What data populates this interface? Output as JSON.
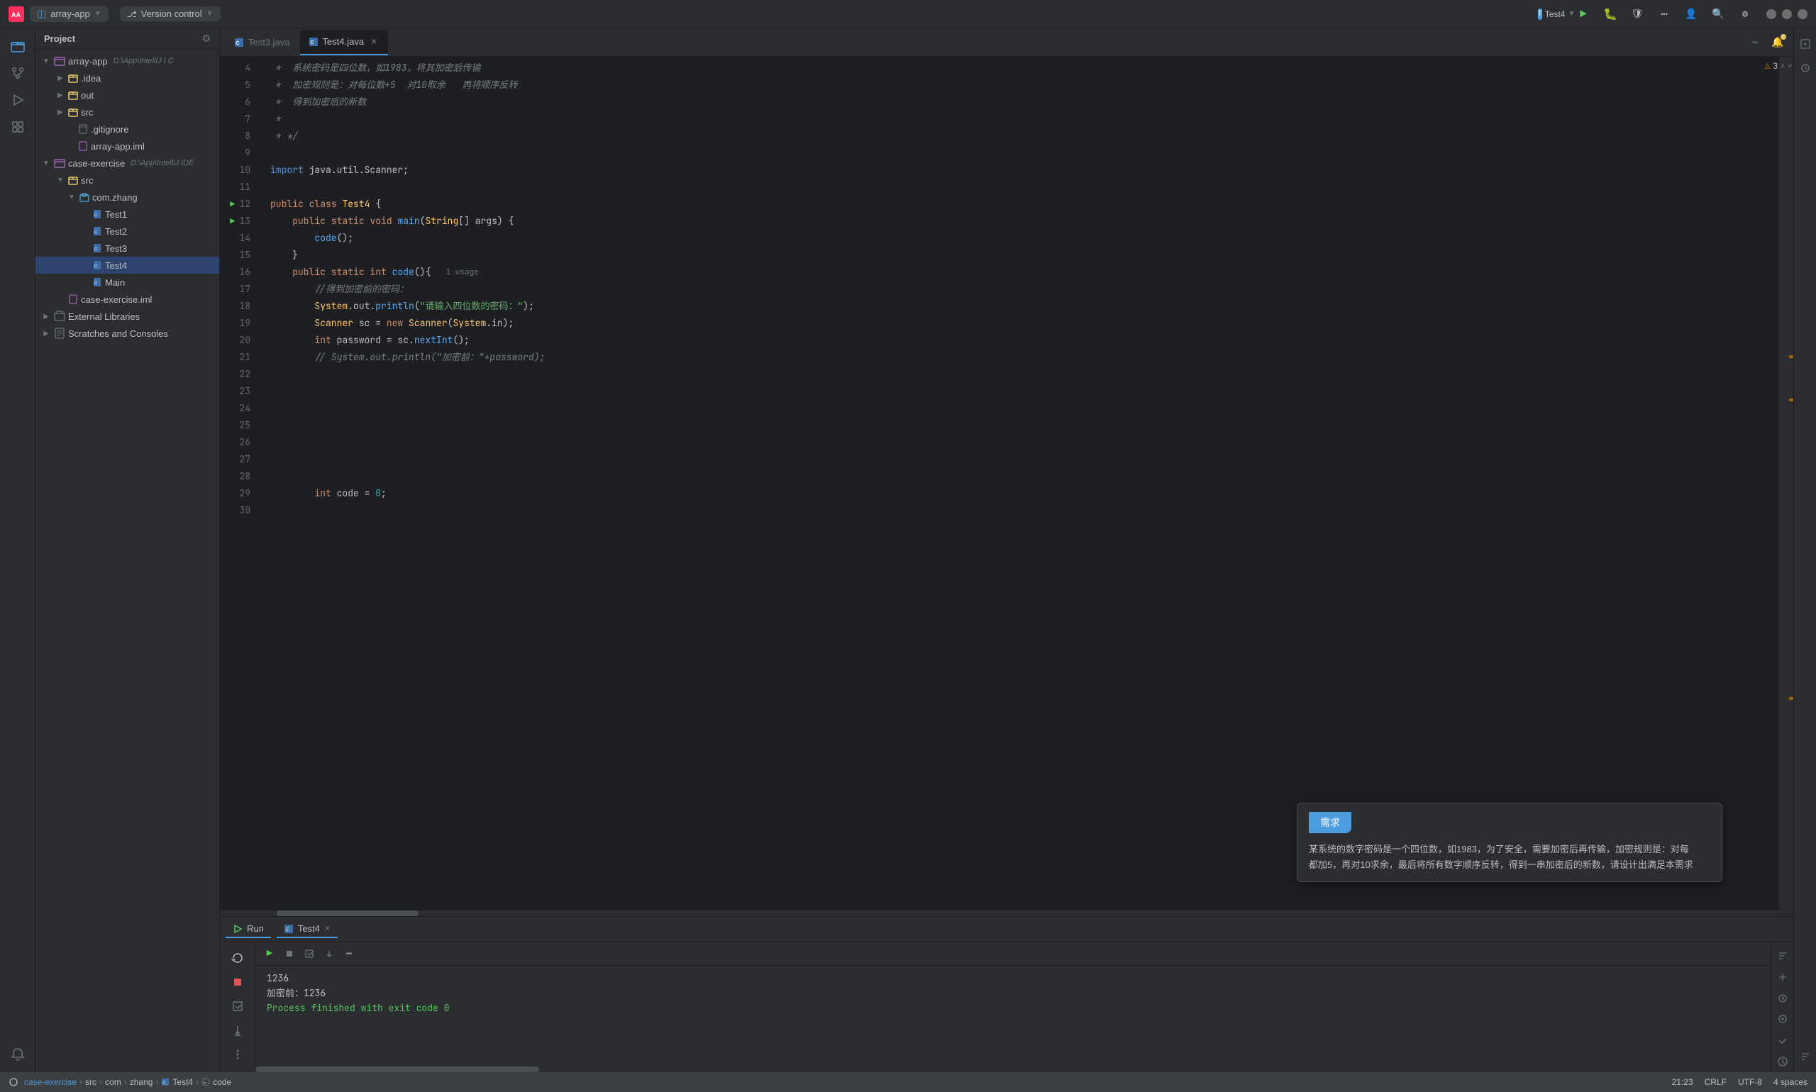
{
  "titlebar": {
    "logo": "AA",
    "project_name": "array-app",
    "vcs_label": "Version control",
    "run_btn": "▶",
    "debug_btn": "🐛",
    "more_btn": "⋯",
    "user_btn": "👤",
    "search_btn": "🔍",
    "settings_btn": "⚙"
  },
  "project": {
    "header": "Project",
    "tree": [
      {
        "id": "array-app",
        "label": "array-app",
        "module": "D:\\App\\IntelliJ I C",
        "level": 0,
        "type": "module",
        "expanded": true
      },
      {
        "id": "idea",
        "label": ".idea",
        "level": 1,
        "type": "folder",
        "expanded": false
      },
      {
        "id": "out",
        "label": "out",
        "level": 1,
        "type": "folder",
        "expanded": false
      },
      {
        "id": "src",
        "label": "src",
        "level": 1,
        "type": "folder",
        "expanded": false
      },
      {
        "id": "gitignore",
        "label": ".gitignore",
        "level": 1,
        "type": "file"
      },
      {
        "id": "array-app-iml",
        "label": "array-app.iml",
        "level": 1,
        "type": "iml"
      },
      {
        "id": "case-exercise",
        "label": "case-exercise",
        "module": "D:\\App\\IntelliJ IDE",
        "level": 0,
        "type": "module",
        "expanded": true
      },
      {
        "id": "src2",
        "label": "src",
        "level": 1,
        "type": "folder",
        "expanded": true
      },
      {
        "id": "com-zhang",
        "label": "com.zhang",
        "level": 2,
        "type": "package",
        "expanded": true
      },
      {
        "id": "Test1",
        "label": "Test1",
        "level": 3,
        "type": "java"
      },
      {
        "id": "Test2",
        "label": "Test2",
        "level": 3,
        "type": "java"
      },
      {
        "id": "Test3",
        "label": "Test3",
        "level": 3,
        "type": "java"
      },
      {
        "id": "Test4",
        "label": "Test4",
        "level": 3,
        "type": "java",
        "selected": true
      },
      {
        "id": "Main",
        "label": "Main",
        "level": 3,
        "type": "java"
      },
      {
        "id": "case-exercise-iml",
        "label": "case-exercise.iml",
        "level": 1,
        "type": "iml"
      },
      {
        "id": "ext-libs",
        "label": "External Libraries",
        "level": 0,
        "type": "ext-lib",
        "expanded": false
      },
      {
        "id": "scratches",
        "label": "Scratches and Consoles",
        "level": 0,
        "type": "scratches",
        "expanded": false
      }
    ]
  },
  "tabs": [
    {
      "id": "test3",
      "label": "Test3.java",
      "type": "java",
      "active": false
    },
    {
      "id": "test4",
      "label": "Test4.java",
      "type": "java",
      "active": true
    }
  ],
  "editor": {
    "warning_count": "⚠ 3",
    "lines": [
      {
        "num": 4,
        "code": " *  系统密码是四位数，如1983，将其加密后传输",
        "type": "comment"
      },
      {
        "num": 5,
        "code": " *  加密规则是：对每位数+5  对10取余   再将顺序反转",
        "type": "comment"
      },
      {
        "num": 6,
        "code": " *  得到加密后的新数",
        "type": "comment"
      },
      {
        "num": 7,
        "code": " *",
        "type": "comment"
      },
      {
        "num": 8,
        "code": " * */",
        "type": "comment"
      },
      {
        "num": 9,
        "code": "",
        "type": "empty"
      },
      {
        "num": 10,
        "code": "import java.util.Scanner;",
        "type": "import"
      },
      {
        "num": 11,
        "code": "",
        "type": "empty"
      },
      {
        "num": 12,
        "code": "public class Test4 {",
        "type": "code",
        "run": true
      },
      {
        "num": 13,
        "code": "    public static void main(String[] args) {",
        "type": "code",
        "run": true
      },
      {
        "num": 14,
        "code": "        code();",
        "type": "code"
      },
      {
        "num": 15,
        "code": "    }",
        "type": "code"
      },
      {
        "num": 16,
        "code": "    public static int code(){  1 usage",
        "type": "code"
      },
      {
        "num": 17,
        "code": "        //得到加密前的密码：",
        "type": "comment-inline"
      },
      {
        "num": 18,
        "code": "        System.out.println(\"请输入四位数的密码：\");",
        "type": "code"
      },
      {
        "num": 19,
        "code": "        Scanner sc = new Scanner(System.in);",
        "type": "code"
      },
      {
        "num": 20,
        "code": "        int password = sc.nextInt();",
        "type": "code"
      },
      {
        "num": 21,
        "code": "        // System.out.println(\"加密前：\"+password);",
        "type": "comment-inline"
      },
      {
        "num": 22,
        "code": "",
        "type": "empty"
      },
      {
        "num": 23,
        "code": "",
        "type": "empty"
      },
      {
        "num": 24,
        "code": "",
        "type": "empty"
      },
      {
        "num": 25,
        "code": "",
        "type": "empty"
      },
      {
        "num": 26,
        "code": "",
        "type": "empty"
      },
      {
        "num": 27,
        "code": "",
        "type": "empty"
      },
      {
        "num": 28,
        "code": "",
        "type": "empty"
      },
      {
        "num": 29,
        "code": "        int code = 0;",
        "type": "code"
      },
      {
        "num": 30,
        "code": "",
        "type": "empty"
      }
    ]
  },
  "tooltip": {
    "header": "需求",
    "body": "某系统的数字密码是一个四位数，如1983，为了安全，需要加密后再传输，加密规则是：对每\n都加5，再对10求余，最后将所有数字顺序反转，得到一串加密后的新数，请设计出满足本需求"
  },
  "bottom_panel": {
    "run_tab": "Run",
    "test4_tab": "Test4",
    "output_lines": [
      "1236",
      "加密前：1236",
      "",
      "Process finished with exit code 0"
    ]
  },
  "status_bar": {
    "position": "21:23",
    "line_ending": "CRLF",
    "encoding": "UTF-8",
    "indent": "4 spaces",
    "breadcrumb": [
      "case-exercise",
      "src",
      "com",
      "zhang",
      "Test4",
      "code"
    ]
  }
}
